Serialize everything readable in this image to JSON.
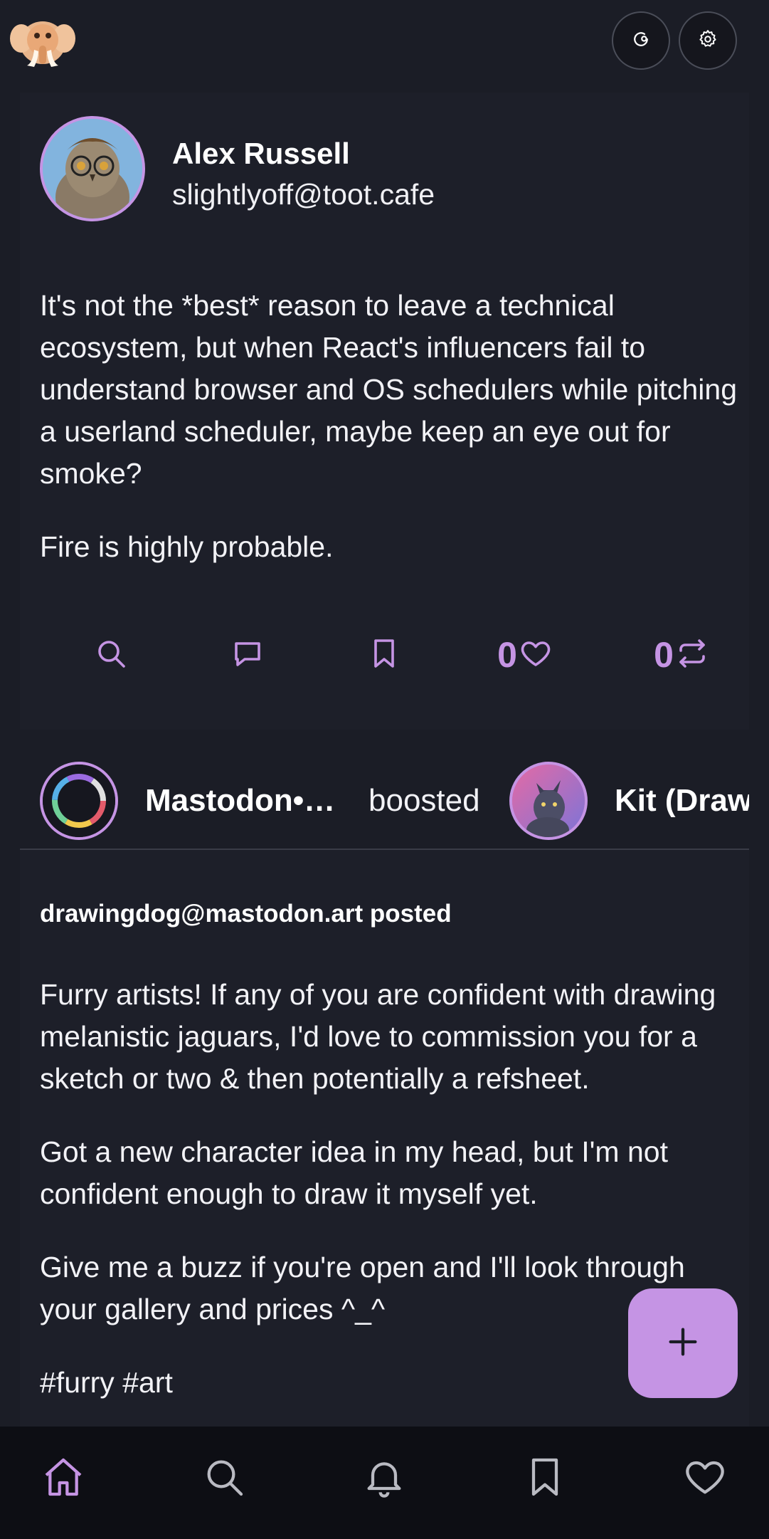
{
  "app": {
    "logo_icon": "mastodon-elephant-icon",
    "colors": {
      "background": "#1b1d26",
      "card": "#1d1f29",
      "accent": "#c594e4",
      "nav": "#0d0e14"
    }
  },
  "header": {
    "buttons": [
      {
        "icon": "refresh-icon"
      },
      {
        "icon": "gear-icon"
      }
    ]
  },
  "post1": {
    "author_name": "Alex Russell",
    "author_handle": "slightlyoff@toot.cafe",
    "paragraphs": [
      "It's not the *best* reason to leave a technical ecosystem, but when React's influencers fail to understand browser and OS schedulers while pitching a userland scheduler, maybe keep an eye out for smoke?",
      "Fire is highly probable."
    ],
    "actions": {
      "search_icon": "search-icon",
      "reply_icon": "comment-icon",
      "bookmark_icon": "bookmark-icon",
      "like_count": "0",
      "boost_count": "0"
    }
  },
  "boost": {
    "booster_name": "Mastodon•…",
    "boosted_label": "boosted",
    "boosted_author_name": "Kit (Draw"
  },
  "post2": {
    "posted_by": "drawingdog@mastodon.art posted",
    "paragraphs": [
      "Furry artists! If any of you are confident with drawing melanistic jaguars, I'd love to commission you for a sketch or two & then potentially a refsheet.",
      "Got a new character idea in my head, but I'm not confident enough to draw it myself yet.",
      "Give me a buzz if you're open and I'll look through your gallery and prices ^_^",
      "#furry #art"
    ]
  },
  "fab": {
    "icon": "plus-icon"
  },
  "bottom_nav": [
    {
      "icon": "home-icon",
      "active": true
    },
    {
      "icon": "search-icon",
      "active": false
    },
    {
      "icon": "bell-icon",
      "active": false
    },
    {
      "icon": "bookmark-icon",
      "active": false
    },
    {
      "icon": "heart-icon",
      "active": false
    }
  ]
}
